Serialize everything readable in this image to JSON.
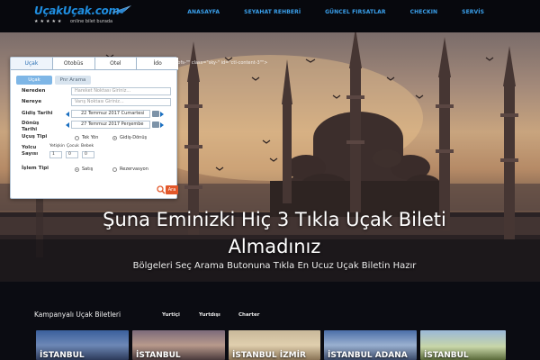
{
  "header": {
    "logo_text": "UçakUçak.com",
    "logo_stars": "★★★★★",
    "logo_tagline": "online bilet burada",
    "nav": [
      "ANASAYFA",
      "SEYAHAT REHBERİ",
      "GÜNCEL FIRSATLAR",
      "CHECKIN",
      "SERVİS"
    ]
  },
  "broken_markup_text": "\"bfs-\"\" class=\"sky-\" id=\"ctl-content-3\"\">",
  "search": {
    "tabs": [
      "Uçak",
      "Otobüs",
      "Otel",
      "İdo"
    ],
    "active_tab": "Uçak",
    "modes": [
      "Uçak",
      "Pnr Arama"
    ],
    "from_label": "Nereden",
    "from_placeholder": "Hareket Noktası Giriniz...",
    "to_label": "Nereye",
    "to_placeholder": "Varış Noktası Giriniz...",
    "depart_label": "Gidiş Tarihi",
    "depart_value": "22 Temmuz 2017 Cumartesi",
    "return_label_1": "Dönüş",
    "return_label_2": "Tarihi",
    "return_value": "27 Temmuz 2017 Perşembe",
    "trip_type_label": "Uçuş Tipi",
    "trip_oneway": "Tek Yön",
    "trip_round": "Gidiş-Dönüş",
    "passenger_label_1": "Yolcu",
    "passenger_label_2": "Sayısı",
    "adult_label": "Yetişkin",
    "child_label": "Çocuk",
    "infant_label": "Bebek",
    "adult_value": "1",
    "child_value": "0",
    "infant_value": "0",
    "process_label": "İşlem Tipi",
    "process_sale": "Satış",
    "process_reservation": "Rezervasyon",
    "search_button": "Ara"
  },
  "hero": {
    "title": "Şuna Eminizki Hiç 3 Tıkla Uçak Bileti Almadınız",
    "subtitle": "Bölgeleri Seç Arama Butonuna Tıkla En Ucuz Uçak Biletin Hazır"
  },
  "campaigns": {
    "title": "Kampanyalı Uçak Biletleri",
    "tabs": [
      "Yurtiçi",
      "Yurtdışı",
      "Charter"
    ],
    "cards": [
      {
        "label": "İSTANBUL"
      },
      {
        "label": "İSTANBUL"
      },
      {
        "label": "İSTANBUL İZMİR"
      },
      {
        "label": "İSTANBUL ADANA"
      },
      {
        "label": "İSTANBUL"
      }
    ]
  },
  "colors": {
    "accent": "#3aa0ec",
    "header_bg": "#07080d",
    "search_button": "#e2572a"
  }
}
